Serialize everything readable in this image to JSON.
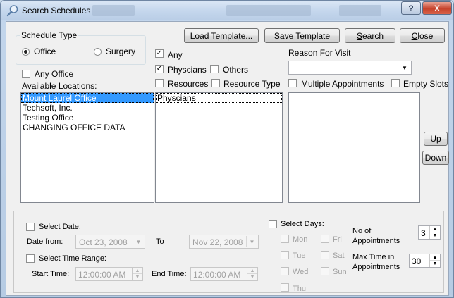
{
  "window": {
    "title": "Search Schedules",
    "help_label": "?",
    "close_glyph": "X"
  },
  "toolbar": {
    "load_template": "Load Template...",
    "save_template": "Save Template",
    "search_prefix": "",
    "search_mnemonic": "S",
    "search_rest": "earch",
    "close_mnemonic": "C",
    "close_rest": "lose"
  },
  "schedule_type": {
    "legend": "Schedule Type",
    "office_label": "Office",
    "surgery_label": "Surgery",
    "selected": "Office"
  },
  "locations": {
    "any_office_label": "Any Office",
    "any_office_checked": false,
    "available_label": "Available Locations:",
    "items": [
      "Mount Laurel Office",
      "Techsoft, Inc.",
      "Testing Office",
      "CHANGING OFFICE DATA"
    ],
    "selected_index": 0
  },
  "providers": {
    "any_label": "Any",
    "any_checked": true,
    "physicians_label": "Physcians",
    "physicians_checked": true,
    "others_label": "Others",
    "others_checked": false,
    "resources_label": "Resources",
    "resources_checked": false,
    "resource_type_label": "Resource Type",
    "resource_type_checked": false,
    "items": [
      "Physcians"
    ]
  },
  "reason": {
    "label": "Reason For Visit",
    "value": "",
    "multiple_label": "Multiple Appointments",
    "multiple_checked": false,
    "empty_slots_label": "Empty Slots",
    "empty_slots_checked": false,
    "items": []
  },
  "order": {
    "up_label": "Up",
    "down_label": "Down"
  },
  "date": {
    "select_date_label": "Select Date:",
    "select_date_checked": false,
    "date_from_label": "Date from:",
    "date_from_value": "Oct 23, 2008",
    "to_label": "To",
    "date_to_value": "Nov 22, 2008",
    "select_time_label": "Select Time Range:",
    "select_time_checked": false,
    "start_time_label": "Start Time:",
    "start_time_value": "12:00:00 AM",
    "end_time_label": "End Time:",
    "end_time_value": "12:00:00 AM"
  },
  "days": {
    "select_days_label": "Select Days:",
    "select_days_checked": false,
    "mon": "Mon",
    "tue": "Tue",
    "wed": "Wed",
    "thu": "Thu",
    "fri": "Fri",
    "sat": "Sat",
    "sun": "Sun"
  },
  "appointments": {
    "no_of_label_1": "No of",
    "no_of_label_2": "Appointments",
    "no_of_value": "3",
    "max_time_label_1": "Max Time in",
    "max_time_label_2": "Appointments",
    "max_time_value": "30"
  },
  "colors": {
    "selection": "#3399ff",
    "close_button": "#c6432c"
  }
}
